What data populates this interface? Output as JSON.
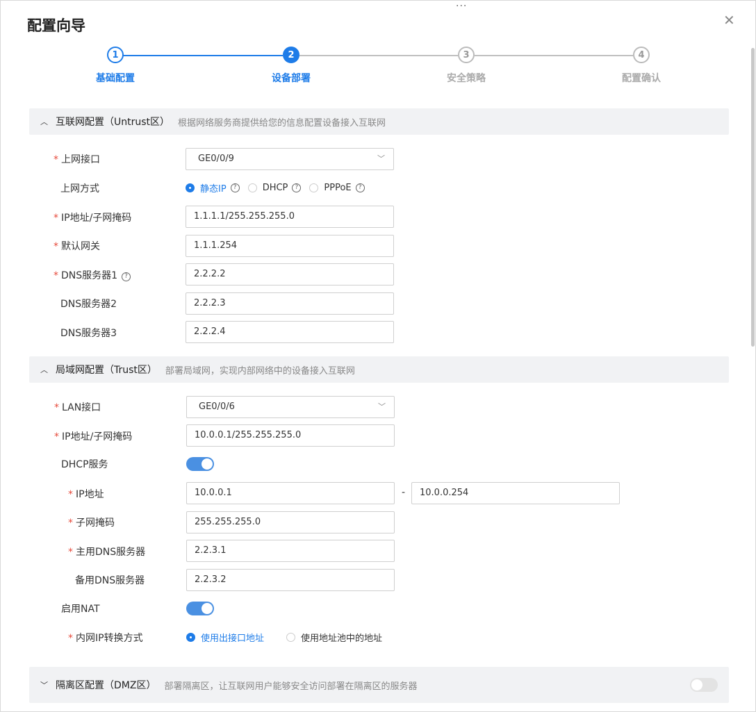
{
  "title": "配置向导",
  "close_glyph": "✕",
  "drag_glyph": "···",
  "steps": [
    {
      "num": "1",
      "label": "基础配置",
      "state": "done"
    },
    {
      "num": "2",
      "label": "设备部署",
      "state": "active"
    },
    {
      "num": "3",
      "label": "安全策略",
      "state": "todo"
    },
    {
      "num": "4",
      "label": "配置确认",
      "state": "todo"
    }
  ],
  "internet": {
    "title": "互联网配置（Untrust区）",
    "desc": "根据网络服务商提供给您的信息配置设备接入互联网",
    "uplink_label": "上网接口",
    "uplink_value": "GE0/0/9",
    "mode_label": "上网方式",
    "modes": [
      "静态IP",
      "DHCP",
      "PPPoE"
    ],
    "ip_label": "IP地址/子网掩码",
    "ip_value": "1.1.1.1/255.255.255.0",
    "gw_label": "默认网关",
    "gw_value": "1.1.1.254",
    "dns1_label": "DNS服务器1",
    "dns1_value": "2.2.2.2",
    "dns2_label": "DNS服务器2",
    "dns2_value": "2.2.2.3",
    "dns3_label": "DNS服务器3",
    "dns3_value": "2.2.2.4"
  },
  "lan": {
    "title": "局域网配置（Trust区）",
    "desc": "部署局域网，实现内部网络中的设备接入互联网",
    "port_label": "LAN接口",
    "port_value": "GE0/0/6",
    "ip_label": "IP地址/子网掩码",
    "ip_value": "10.0.0.1/255.255.255.0",
    "dhcp_label": "DHCP服务",
    "pool_label": "IP地址",
    "pool_start": "10.0.0.1",
    "pool_sep": "-",
    "pool_end": "10.0.0.254",
    "mask_label": "子网掩码",
    "mask_value": "255.255.255.0",
    "pdns_label": "主用DNS服务器",
    "pdns_value": "2.2.3.1",
    "sdns_label": "备用DNS服务器",
    "sdns_value": "2.2.3.2",
    "nat_label": "启用NAT",
    "nat_mode_label": "内网IP转换方式",
    "nat_modes": [
      "使用出接口地址",
      "使用地址池中的地址"
    ]
  },
  "dmz": {
    "title": "隔离区配置（DMZ区）",
    "desc": "部署隔离区，让互联网用户能够安全访问部署在隔离区的服务器"
  }
}
